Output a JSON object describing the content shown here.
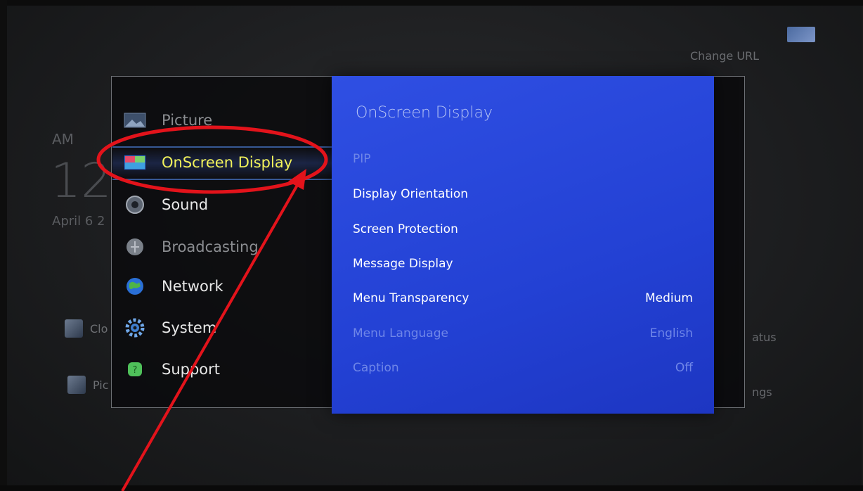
{
  "background": {
    "ampm": "AM",
    "hour": "12",
    "date": "April 6 2",
    "change_url": "Change URL",
    "row1_text": "Clo",
    "row2_text": "Pic",
    "right1_text": "atus",
    "right2_text": "ngs"
  },
  "menu": {
    "items": [
      {
        "label": "Picture",
        "icon": "picture-icon"
      },
      {
        "label": "OnScreen Display",
        "icon": "onscreen-display-icon"
      },
      {
        "label": "Sound",
        "icon": "sound-icon"
      },
      {
        "label": "Broadcasting",
        "icon": "broadcasting-icon"
      },
      {
        "label": "Network",
        "icon": "network-icon"
      },
      {
        "label": "System",
        "icon": "system-icon"
      },
      {
        "label": "Support",
        "icon": "support-icon"
      }
    ],
    "selected": "OnScreen Display"
  },
  "submenu": {
    "title": "OnScreen Display",
    "options": [
      {
        "label": "PIP",
        "value": "",
        "enabled": false
      },
      {
        "label": "Display Orientation",
        "value": "",
        "enabled": true
      },
      {
        "label": "Screen Protection",
        "value": "",
        "enabled": true
      },
      {
        "label": "Message Display",
        "value": "",
        "enabled": true
      },
      {
        "label": "Menu Transparency",
        "value": "Medium",
        "enabled": true
      },
      {
        "label": "Menu Language",
        "value": "English",
        "enabled": false
      },
      {
        "label": "Caption",
        "value": "Off",
        "enabled": false
      }
    ]
  },
  "colors": {
    "panel_blue": "#2a49dc",
    "selected_text": "#f2f25a",
    "annotation_red": "#e3131b"
  }
}
